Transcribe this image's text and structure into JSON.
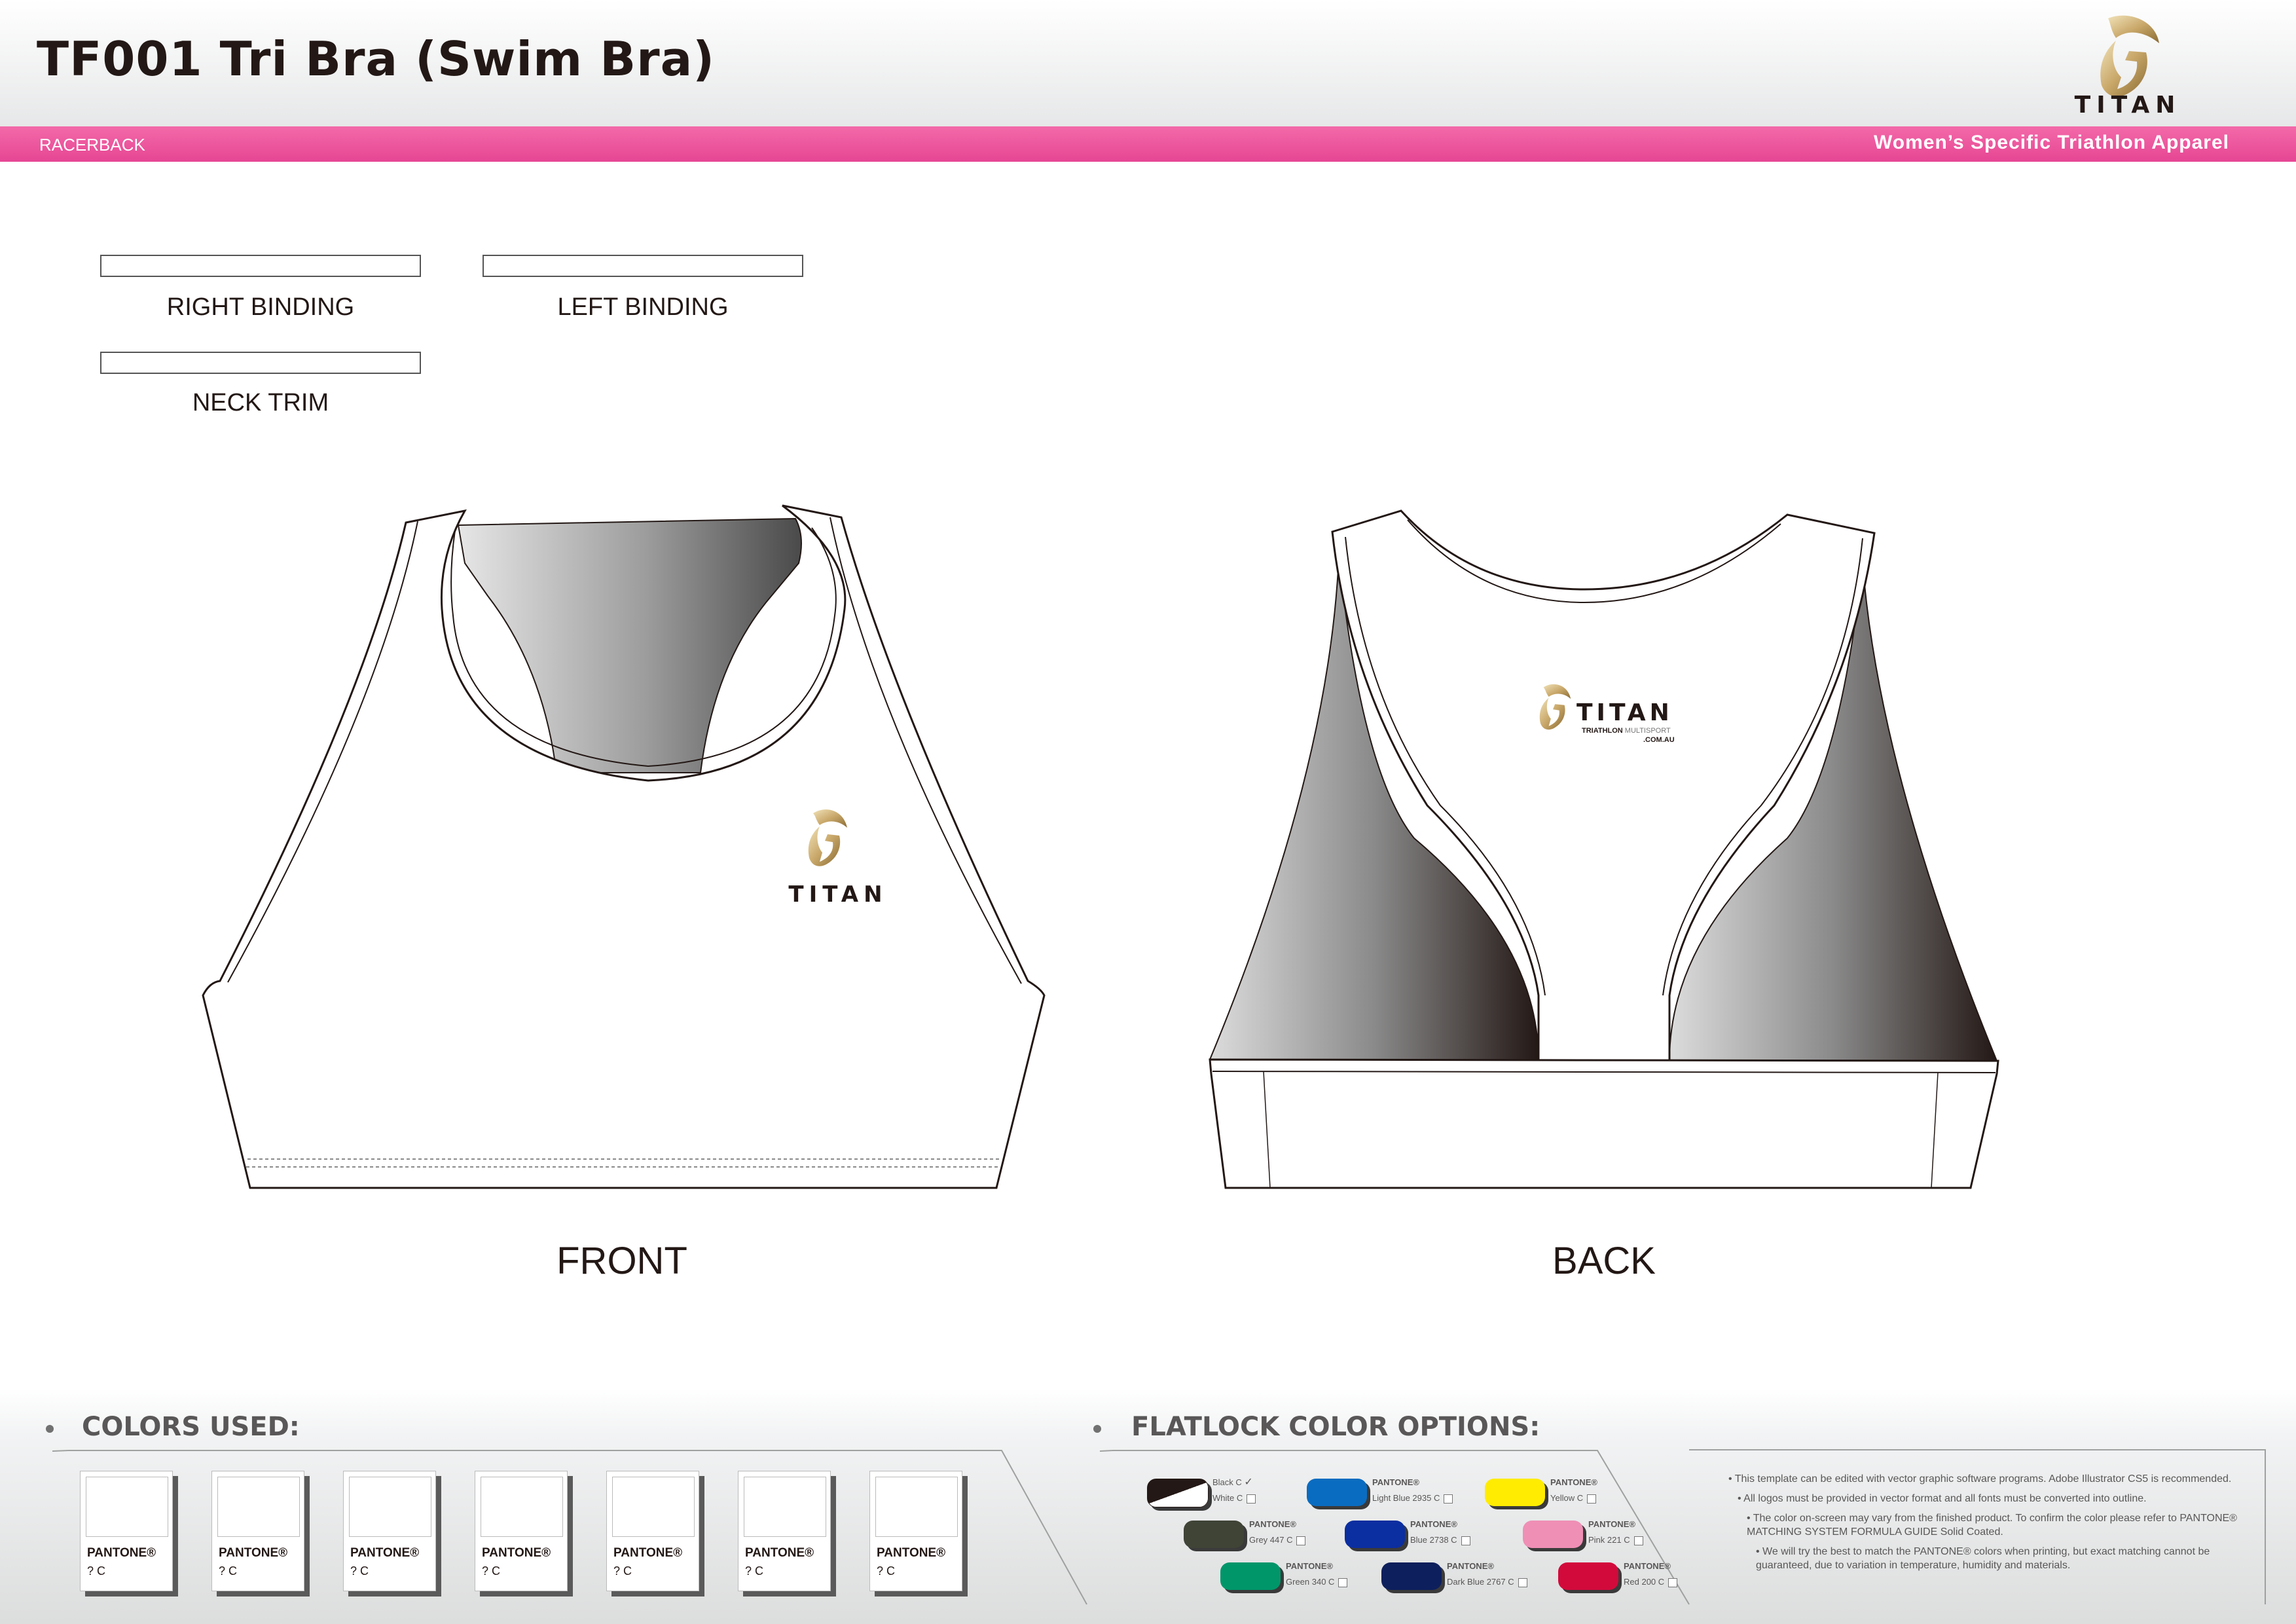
{
  "header": {
    "title": "TF001 Tri Bra (Swim Bra)",
    "brand": "TITAN",
    "subtitle": "RACERBACK",
    "tagline": "Women’s Specific Triathlon Apparel"
  },
  "parts": {
    "right_binding": "RIGHT BINDING",
    "left_binding": "LEFT BINDING",
    "neck_trim": "NECK TRIM"
  },
  "views": {
    "front": "FRONT",
    "back": "BACK",
    "front_logo_text": "TITAN",
    "back_logo_text": "TITAN",
    "back_logo_sub": "TRIATHLON",
    "back_logo_sub2": "MULTISPORT",
    "back_logo_url": ".COM.AU"
  },
  "colors_used": {
    "title": "COLORS USED:",
    "chips": [
      {
        "label": "PANTONE®",
        "code": "? C"
      },
      {
        "label": "PANTONE®",
        "code": "? C"
      },
      {
        "label": "PANTONE®",
        "code": "? C"
      },
      {
        "label": "PANTONE®",
        "code": "? C"
      },
      {
        "label": "PANTONE®",
        "code": "? C"
      },
      {
        "label": "PANTONE®",
        "code": "? C"
      },
      {
        "label": "PANTONE®",
        "code": "? C"
      }
    ]
  },
  "flatlock": {
    "title": "FLATLOCK COLOR OPTIONS:",
    "options": [
      {
        "line1": "Black C",
        "line2": "White C",
        "color": "#231815",
        "color2": "#ffffff",
        "checked": true
      },
      {
        "line1": "PANTONE®",
        "line2": "Light Blue 2935 C",
        "color": "#0a6cc0"
      },
      {
        "line1": "PANTONE®",
        "line2": "Yellow C",
        "color": "#ffec00"
      },
      {
        "line1": "PANTONE®",
        "line2": "Grey 447 C",
        "color": "#3f4437"
      },
      {
        "line1": "PANTONE®",
        "line2": "Blue 2738 C",
        "color": "#0b2ea0"
      },
      {
        "line1": "PANTONE®",
        "line2": "Pink 221 C",
        "color": "#ef8fb6"
      },
      {
        "line1": "PANTONE®",
        "line2": "Green 340 C",
        "color": "#00966a"
      },
      {
        "line1": "PANTONE®",
        "line2": "Dark Blue 2767 C",
        "color": "#0d1f5c"
      },
      {
        "line1": "PANTONE®",
        "line2": "Red 200 C",
        "color": "#d20a3c"
      }
    ]
  },
  "notes": [
    "• This template can be edited with vector graphic software programs. Adobe Illustrator CS5 is recommended.",
    "• All logos must be provided in vector format and all fonts must be converted into outline.",
    "• The color on-screen may vary from the finished product. To confirm the color please refer to PANTONE® MATCHING SYSTEM FORMULA GUIDE Solid Coated.",
    "• We will try the best to match the PANTONE® colors when printing, but exact matching cannot be guaranteed, due to variation in temperature, humidity and materials."
  ],
  "theme": {
    "pink": "#e64593",
    "gold": "#c9a86a",
    "outline": "#231815"
  }
}
